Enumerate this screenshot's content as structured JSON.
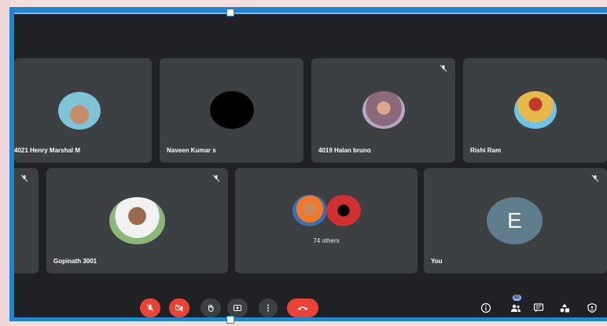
{
  "participants": [
    {
      "name": "4021 Henry Marshal M",
      "muted": false
    },
    {
      "name": "Naveen Kumar s",
      "muted": false
    },
    {
      "name": "4019 Halan bruno",
      "muted": true
    },
    {
      "name": "Rishi Ram",
      "muted": false
    },
    {
      "name": "Gopinath 3001",
      "muted": true
    },
    {
      "name": "You",
      "initial": "E",
      "muted": true
    }
  ],
  "others": {
    "label": "74 others"
  },
  "people_count": "82",
  "colors": {
    "stage": "#202124",
    "tile": "#3c4043",
    "danger": "#ea4335",
    "self_avatar": "#5f7d8c",
    "selection": "#1f85d1"
  },
  "controls": [
    "mic-off-icon",
    "camera-off-icon",
    "raise-hand-icon",
    "present-icon",
    "more-options-icon",
    "end-call-icon"
  ],
  "right_controls": [
    "meeting-info-icon",
    "people-icon",
    "chat-icon",
    "activities-icon",
    "host-controls-icon"
  ]
}
